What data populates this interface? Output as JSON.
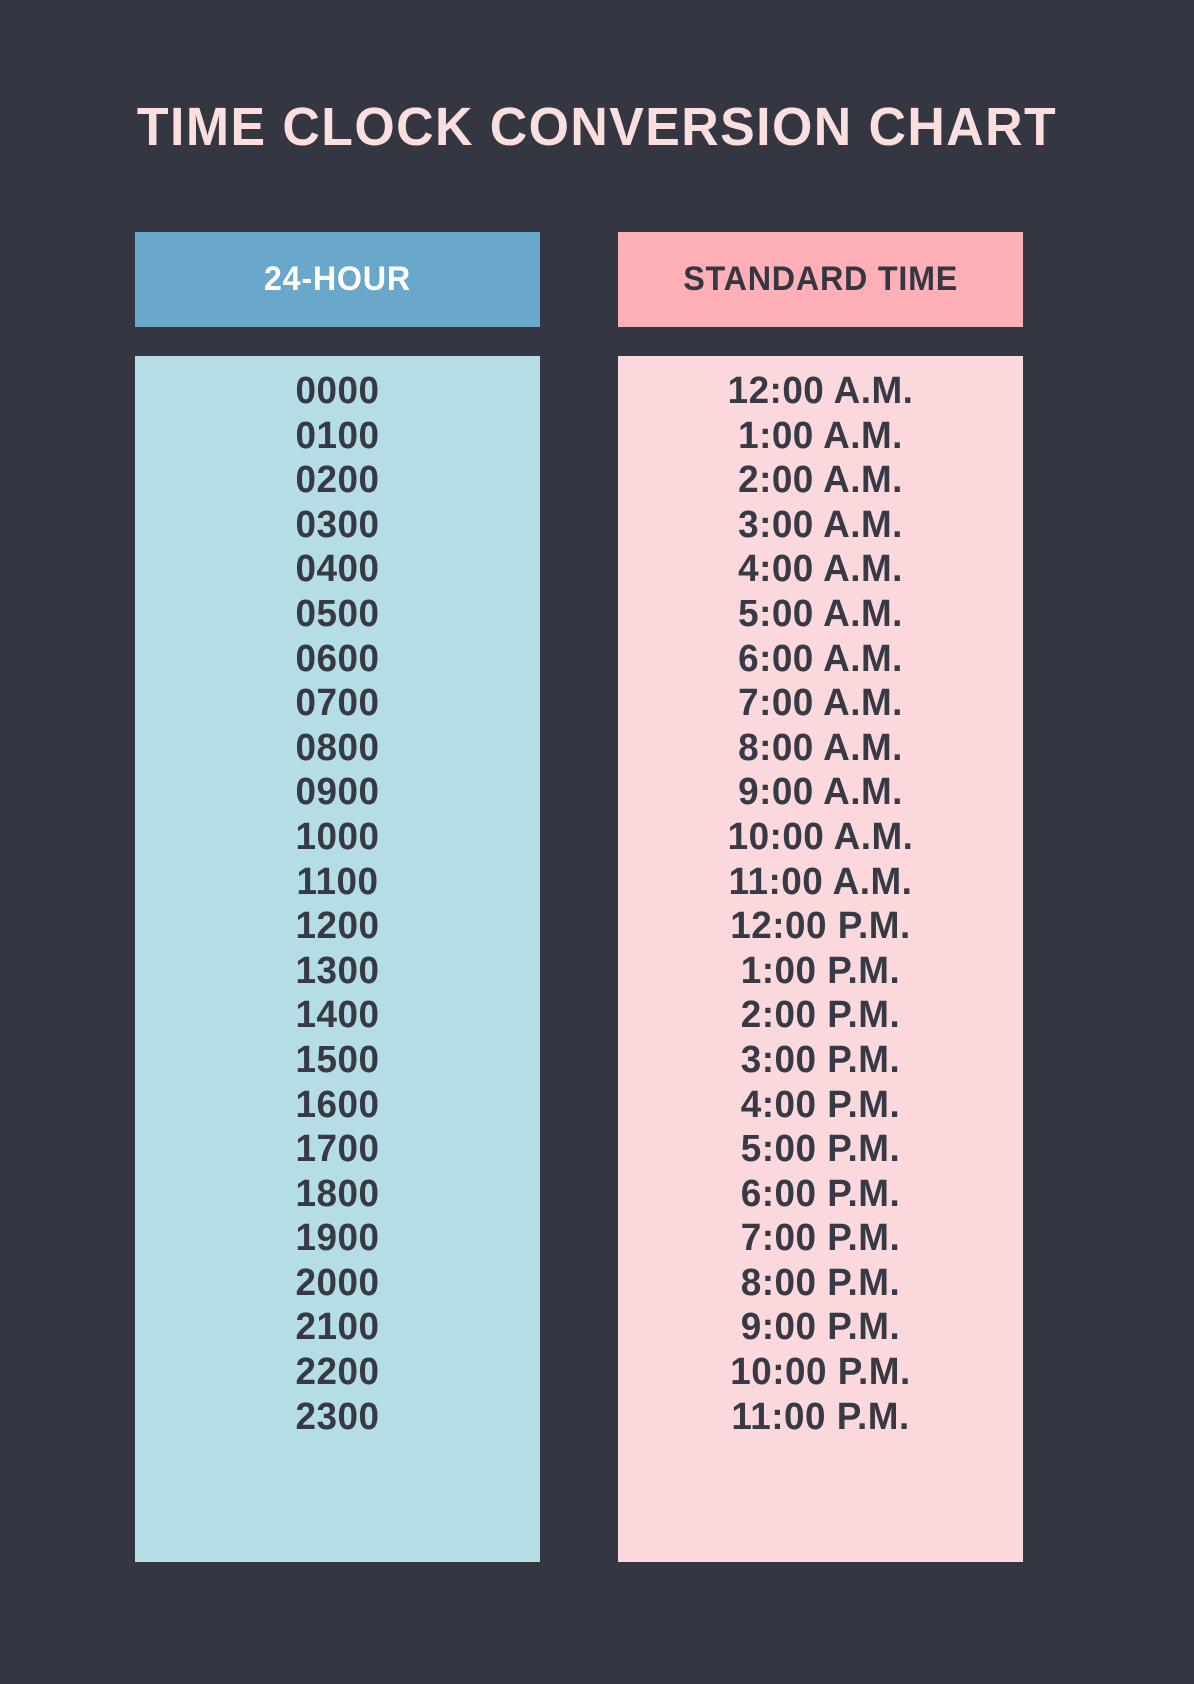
{
  "page": {
    "title": "TIME CLOCK CONVERSION CHART",
    "background_color": "#343741",
    "title_color": "#FBDEDE"
  },
  "columns": {
    "left": {
      "header_label": "24-HOUR",
      "header_bg": "#69A8CB",
      "header_text_color": "#FFFFFF",
      "body_bg": "#B5DDE5",
      "body_text_color": "#373A45"
    },
    "right": {
      "header_label": "STANDARD TIME",
      "header_bg": "#FFB0B7",
      "header_text_color": "#343741",
      "body_bg": "#FBD8DC",
      "body_text_color": "#373A45"
    }
  },
  "chart_data": {
    "type": "table",
    "title": "TIME CLOCK CONVERSION CHART",
    "columns": [
      "24-HOUR",
      "STANDARD TIME"
    ],
    "rows": [
      [
        "0000",
        "12:00 A.M."
      ],
      [
        "0100",
        "1:00 A.M."
      ],
      [
        "0200",
        "2:00 A.M."
      ],
      [
        "0300",
        "3:00 A.M."
      ],
      [
        "0400",
        "4:00 A.M."
      ],
      [
        "0500",
        "5:00 A.M."
      ],
      [
        "0600",
        "6:00 A.M."
      ],
      [
        "0700",
        "7:00 A.M."
      ],
      [
        "0800",
        "8:00 A.M."
      ],
      [
        "0900",
        "9:00 A.M."
      ],
      [
        "1000",
        "10:00 A.M."
      ],
      [
        "1100",
        "11:00 A.M."
      ],
      [
        "1200",
        "12:00 P.M."
      ],
      [
        "1300",
        "1:00 P.M."
      ],
      [
        "1400",
        "2:00 P.M."
      ],
      [
        "1500",
        "3:00 P.M."
      ],
      [
        "1600",
        "4:00 P.M."
      ],
      [
        "1700",
        "5:00 P.M."
      ],
      [
        "1800",
        "6:00 P.M."
      ],
      [
        "1900",
        "7:00 P.M."
      ],
      [
        "2000",
        "8:00 P.M."
      ],
      [
        "2100",
        "9:00 P.M."
      ],
      [
        "2200",
        "10:00 P.M."
      ],
      [
        "2300",
        "11:00 P.M."
      ]
    ]
  }
}
